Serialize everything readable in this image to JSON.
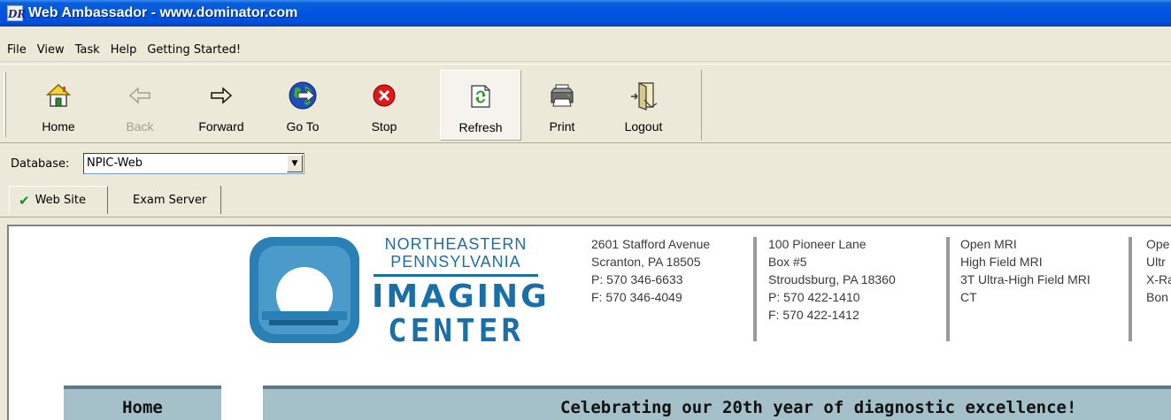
{
  "window": {
    "title": "Web Ambassador - www.dominator.com",
    "app_icon_text": "DR"
  },
  "menu": [
    "File",
    "View",
    "Task",
    "Help",
    "Getting Started!"
  ],
  "toolbar": {
    "buttons": [
      {
        "label": "Home",
        "icon": "home-icon",
        "enabled": true
      },
      {
        "label": "Back",
        "icon": "back-arrow-icon",
        "enabled": false
      },
      {
        "label": "Forward",
        "icon": "forward-arrow-icon",
        "enabled": true
      },
      {
        "label": "Go To",
        "icon": "globe-icon",
        "enabled": true
      },
      {
        "label": "Stop",
        "icon": "stop-icon",
        "enabled": true
      },
      {
        "label": "Refresh",
        "icon": "refresh-icon",
        "enabled": true,
        "pressed": true
      },
      {
        "label": "Print",
        "icon": "printer-icon",
        "enabled": true
      },
      {
        "label": "Logout",
        "icon": "logout-icon",
        "enabled": true
      }
    ]
  },
  "database": {
    "label": "Database:",
    "value": "NPIC-Web"
  },
  "tabs": [
    {
      "label": "Web Site",
      "active": true
    },
    {
      "label": "Exam Server",
      "active": false
    }
  ],
  "site": {
    "logo": {
      "line1": "NORTHEASTERN",
      "line2": "PENNSYLVANIA",
      "line3": "IMAGING",
      "line4": "CENTER"
    },
    "address1": [
      "2601 Stafford Avenue",
      "Scranton, PA 18505",
      "P: 570 346-6633",
      "F: 570 346-4049"
    ],
    "address2": [
      "100 Pioneer Lane",
      "Box #5",
      "Stroudsburg, PA 18360",
      "P: 570 422-1410",
      "F: 570 422-1412"
    ],
    "services1": [
      "Open MRI",
      "High Field MRI",
      "3T Ultra-High Field MRI",
      "CT"
    ],
    "services2": [
      "Ope",
      "Ultr",
      "X-Ra",
      "Bon"
    ],
    "nav_home": "Home",
    "banner": "Celebrating our 20th year of diagnostic excellence!"
  },
  "colors": {
    "titlebar": "#0054e3",
    "logo_blue": "#1a6fa8",
    "nav_bar": "#a4c0c9"
  }
}
